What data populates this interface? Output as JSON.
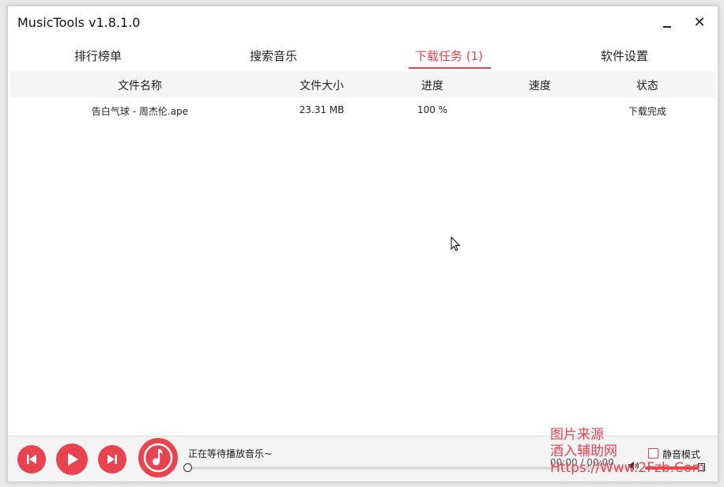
{
  "window": {
    "title": "MusicTools v1.8.1.0",
    "close_glyph": "✕"
  },
  "tabs": [
    {
      "label": "排行榜单"
    },
    {
      "label": "搜索音乐"
    },
    {
      "label": "下载任务 (1)"
    },
    {
      "label": "软件设置"
    }
  ],
  "active_tab": 2,
  "table": {
    "columns": [
      "文件名称",
      "文件大小",
      "进度",
      "速度",
      "状态"
    ],
    "rows": [
      {
        "name": "告白气球 - 周杰伦.ape",
        "size": "23.31 MB",
        "progress": "100 %",
        "speed": "",
        "status": "下载完成"
      }
    ]
  },
  "player": {
    "now_playing": "正在等待播放音乐~",
    "time": "00:00 / 00:00",
    "progress": 0,
    "volume": 1.0,
    "mute_label": "静音模式",
    "mute_checked": false
  },
  "watermark": {
    "line1": "图片来源",
    "line2": "酒入辅助网",
    "line3": "Https://Www.2Fzb.Com"
  },
  "colors": {
    "accent": "#e8434e",
    "header_bg": "#f5f5f5",
    "player_bg": "#f3f3f3"
  }
}
